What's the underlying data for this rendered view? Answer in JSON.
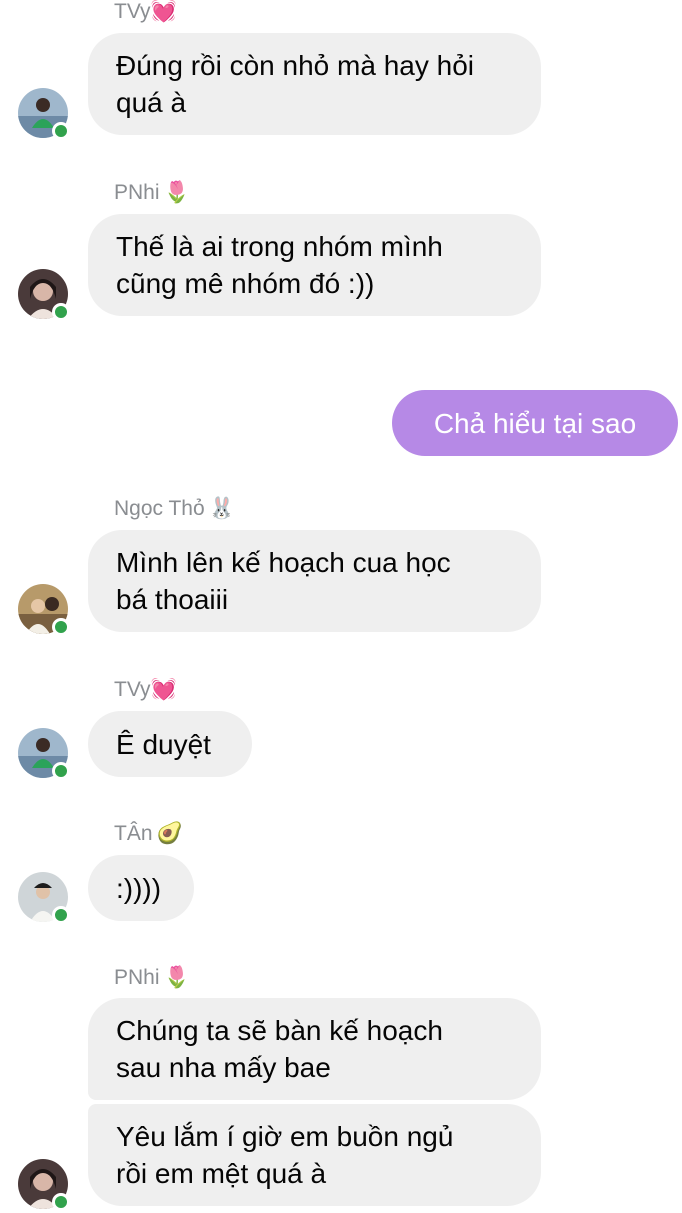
{
  "messages": [
    {
      "sender": "TVy",
      "sender_emoji": "💓",
      "text": "Đúng rồi còn nhỏ mà hay hỏi\nquá à"
    },
    {
      "sender": "PNhi",
      "sender_emoji": "🌷",
      "text": "Thế là ai trong nhóm mình\ncũng mê nhóm đó :))"
    },
    {
      "sender": "",
      "text": "Chả hiểu tại sao",
      "mine": true
    },
    {
      "sender": "Ngọc Thỏ",
      "sender_emoji": "🐰",
      "text": "Mình lên kế hoạch cua học\nbá thoaiii"
    },
    {
      "sender": "TVy",
      "sender_emoji": "💓",
      "text": "Ê duyệt"
    },
    {
      "sender": "TÂn",
      "sender_emoji": "🥑",
      "text": ":))))"
    },
    {
      "sender": "PNhi",
      "sender_emoji": "🌷",
      "text": "Chúng ta sẽ bàn kế hoạch\nsau nha mấy bae",
      "text2": "Yêu lắm í giờ em buồn ngủ\nrồi em mệt quá à"
    }
  ],
  "colors": {
    "bubble_other": "#efefef",
    "bubble_mine": "#b689e6",
    "sender_name": "#8a8d91",
    "online_dot": "#31a24c"
  }
}
